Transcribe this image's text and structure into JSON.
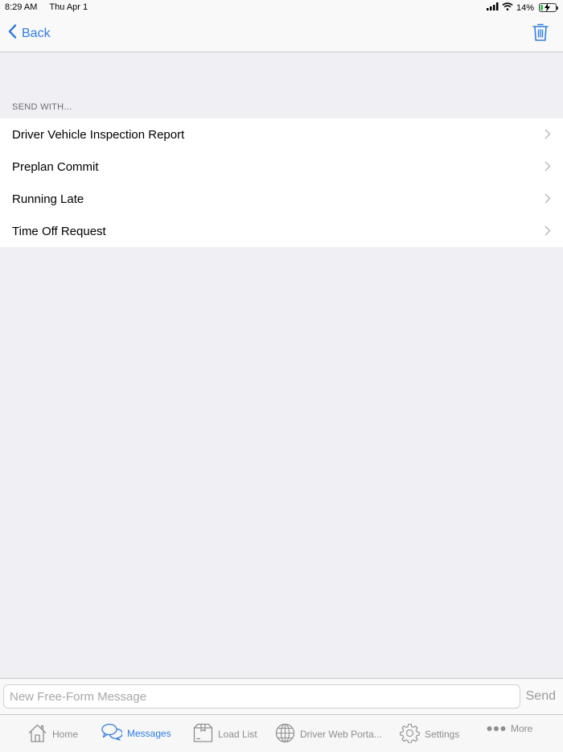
{
  "status_bar": {
    "time": "8:29 AM",
    "date": "Thu Apr 1",
    "battery_percent": "14%"
  },
  "nav": {
    "back_label": "Back",
    "trash_icon": "trash-icon"
  },
  "section": {
    "header": "SEND WITH..."
  },
  "list": {
    "items": [
      {
        "label": "Driver Vehicle Inspection Report"
      },
      {
        "label": "Preplan Commit"
      },
      {
        "label": "Running Late"
      },
      {
        "label": "Time Off Request"
      }
    ]
  },
  "compose": {
    "placeholder": "New Free-Form Message",
    "value": "",
    "send_label": "Send"
  },
  "tab_bar": {
    "tabs": [
      {
        "label": "Home",
        "icon": "home-icon",
        "active": false
      },
      {
        "label": "Messages",
        "icon": "chat-bubbles-icon",
        "active": true
      },
      {
        "label": "Load List",
        "icon": "package-icon",
        "active": false
      },
      {
        "label": "Driver Web Porta...",
        "icon": "globe-icon",
        "active": false
      },
      {
        "label": "Settings",
        "icon": "gear-icon",
        "active": false
      },
      {
        "label": "More",
        "icon": "more-dots-icon",
        "active": false
      }
    ]
  },
  "colors": {
    "accent": "#2f7de1",
    "background": "#efeff4",
    "tab_inactive": "#8e8e93"
  }
}
